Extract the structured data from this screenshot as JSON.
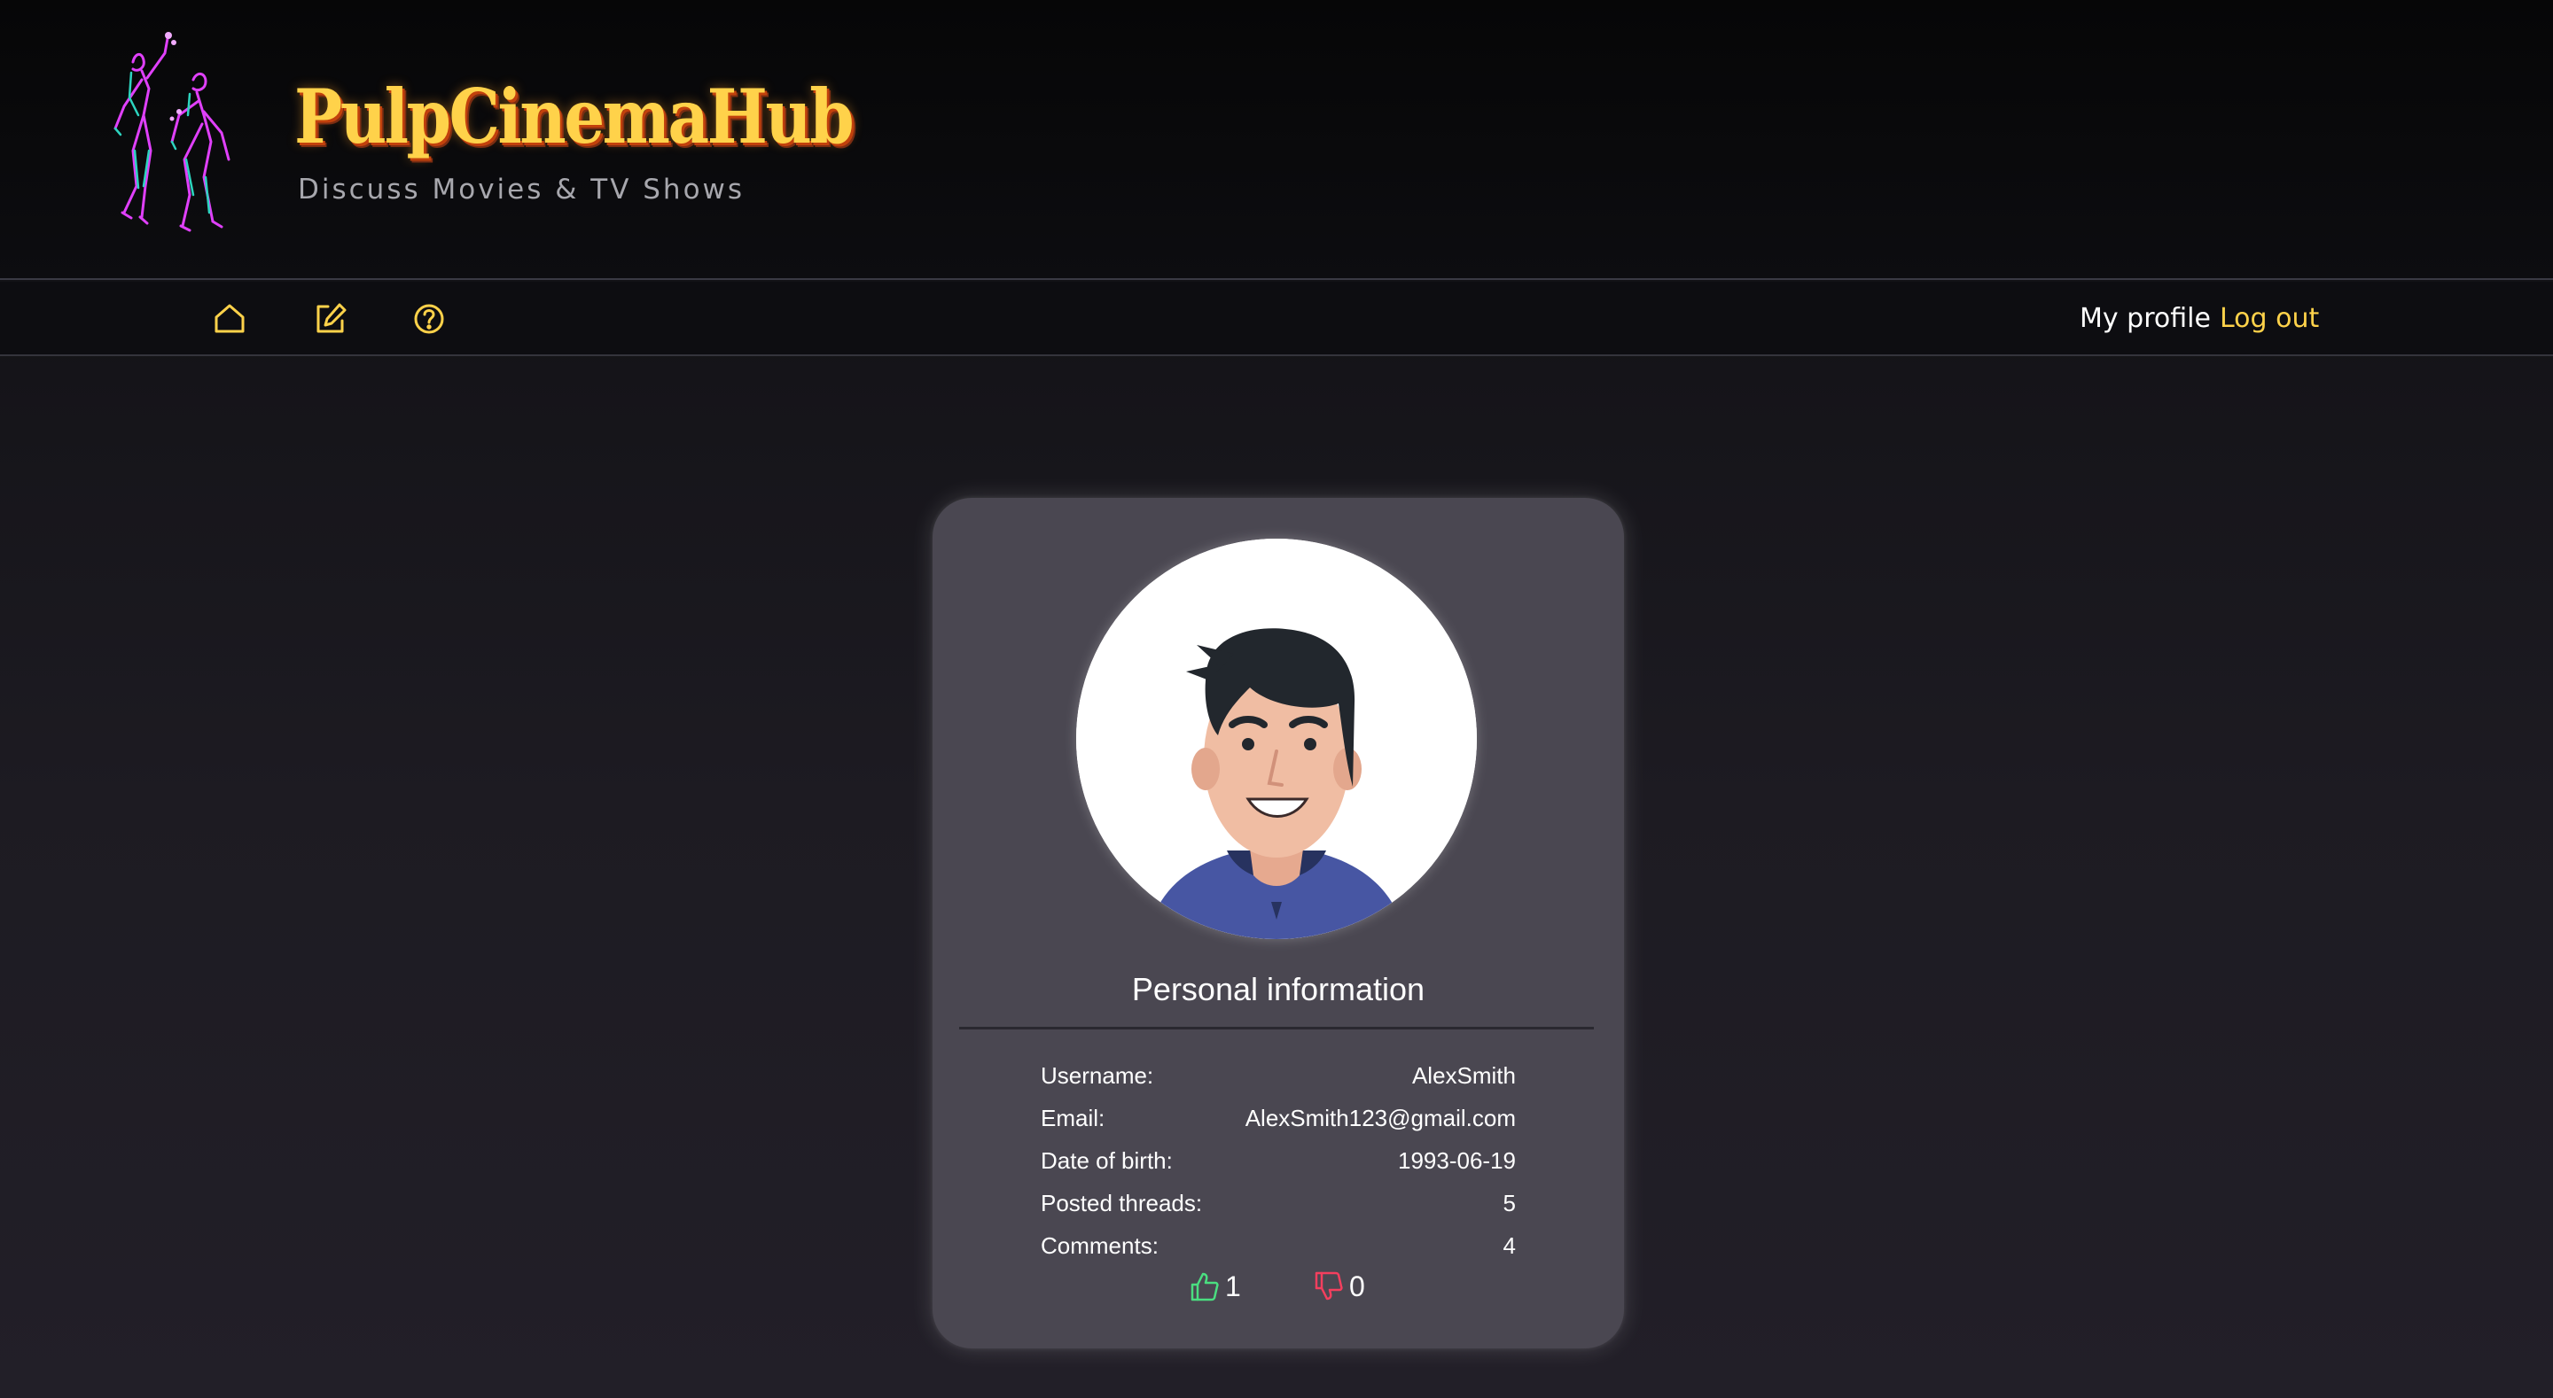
{
  "site": {
    "title": "PulpCinemaHub",
    "tagline": "Discuss Movies & TV Shows",
    "logo_icon": "neon-dancers-icon"
  },
  "nav": {
    "icons": [
      "home-icon",
      "edit-icon",
      "help-icon"
    ],
    "my_profile": "My profile",
    "log_out": "Log out",
    "accent_color": "#ffd24a"
  },
  "profile": {
    "section_title": "Personal information",
    "fields": [
      {
        "label": "Username:",
        "value": "AlexSmith"
      },
      {
        "label": "Email:",
        "value": "AlexSmith123@gmail.com"
      },
      {
        "label": "Date of birth:",
        "value": "1993-06-19"
      },
      {
        "label": "Posted threads:",
        "value": "5"
      },
      {
        "label": "Comments:",
        "value": "4"
      }
    ],
    "likes": "1",
    "dislikes": "0",
    "like_color": "#4ade80",
    "dislike_color": "#f43f5e"
  }
}
